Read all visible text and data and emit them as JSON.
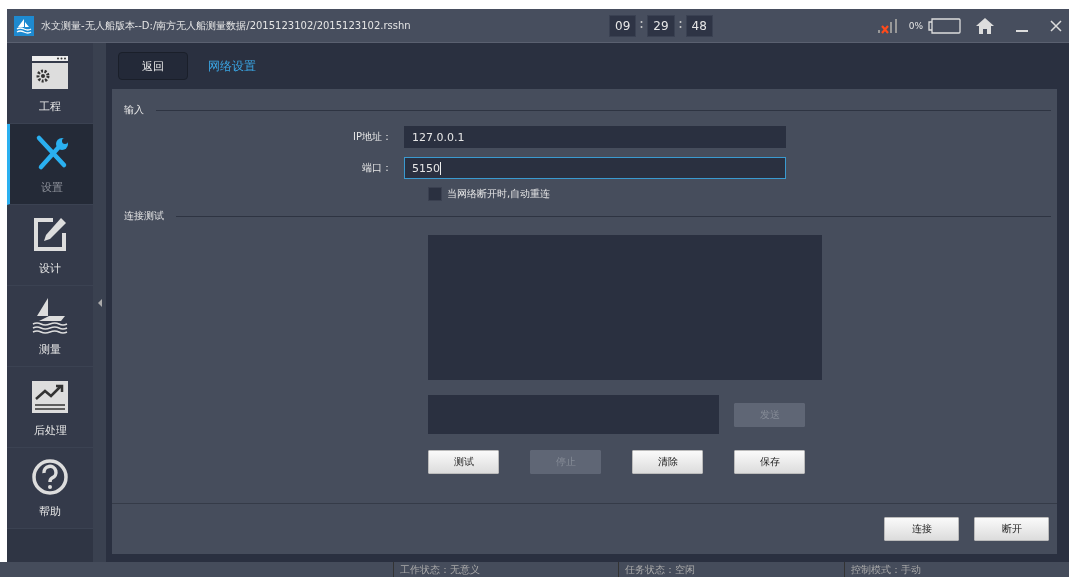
{
  "window": {
    "title": "水文测量-无人船版本--D:/南方无人船测量数据/2015123102/2015123102.rsshn"
  },
  "clock": [
    "09",
    "29",
    "48"
  ],
  "battery": {
    "reading": "0%"
  },
  "sidebar": {
    "items": [
      {
        "label": "工程",
        "kind": "project",
        "selected": false
      },
      {
        "label": "设置",
        "kind": "settings",
        "selected": true
      },
      {
        "label": "设计",
        "kind": "design",
        "selected": false
      },
      {
        "label": "测量",
        "kind": "survey",
        "selected": false
      },
      {
        "label": "后处理",
        "kind": "postprocess",
        "selected": false
      },
      {
        "label": "帮助",
        "kind": "help",
        "selected": false
      }
    ]
  },
  "header": {
    "back": "返回",
    "title": "网络设置"
  },
  "input_section": {
    "title": "输入",
    "fields": [
      {
        "label": "IP地址：",
        "value": "127.0.0.1",
        "focused": false
      },
      {
        "label": "端口：",
        "value": "5150",
        "focused": true
      }
    ],
    "auto_reconnect": {
      "label": "当网络断开时,自动重连",
      "checked": false
    }
  },
  "test_section": {
    "title": "连接测试",
    "send": {
      "label": "发送",
      "disabled": true
    },
    "buttons": [
      {
        "label": "测试",
        "disabled": false
      },
      {
        "label": "停止",
        "disabled": true
      },
      {
        "label": "清除",
        "disabled": false
      },
      {
        "label": "保存",
        "disabled": false
      }
    ]
  },
  "footer_buttons": [
    "连接",
    "断开"
  ],
  "status_bar": [
    "工作状态：无意义",
    "任务状态：空闲",
    "控制模式：手动"
  ]
}
